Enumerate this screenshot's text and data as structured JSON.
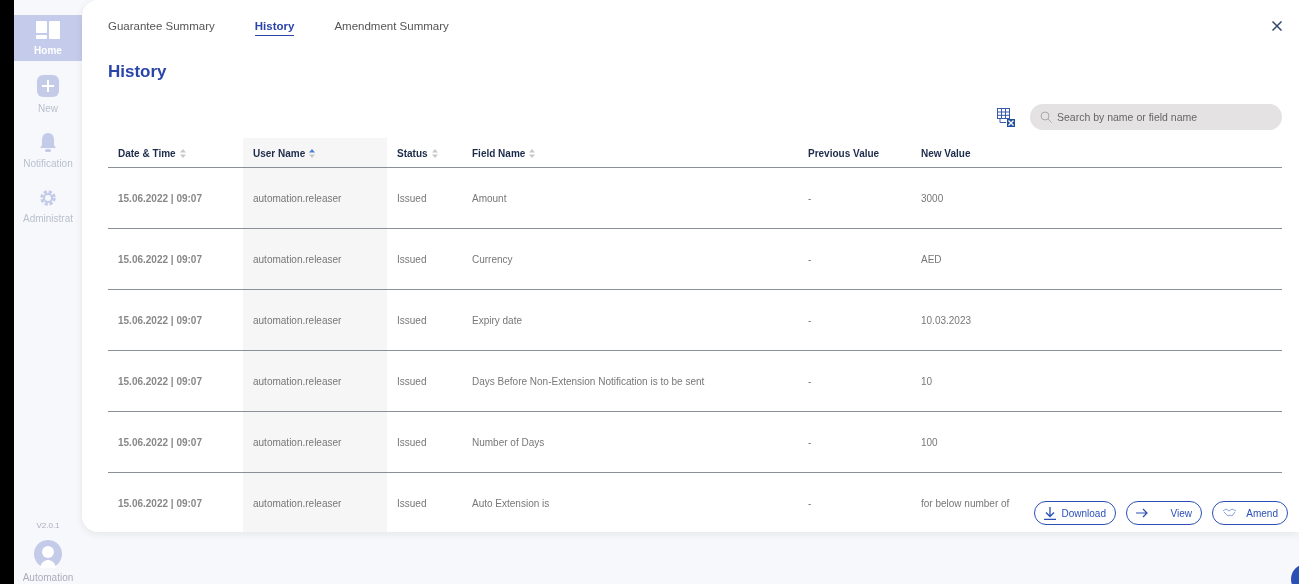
{
  "sidebar": {
    "items": [
      {
        "label": "Home",
        "kind": "home",
        "selected": true
      },
      {
        "label": "New",
        "kind": "new",
        "selected": false
      },
      {
        "label": "Notification",
        "kind": "bell",
        "selected": false
      },
      {
        "label": "Administrat",
        "kind": "gear",
        "selected": false
      }
    ],
    "version": "V2.0.1",
    "user": "Automation"
  },
  "tabs": [
    {
      "label": "Guarantee Summary",
      "selected": false
    },
    {
      "label": "History",
      "selected": true
    },
    {
      "label": "Amendment Summary",
      "selected": false
    }
  ],
  "title": "History",
  "search": {
    "placeholder": "Search by name or field name"
  },
  "table": {
    "columns": [
      {
        "label": "Date & Time",
        "kind": "sortable"
      },
      {
        "label": "User Name",
        "kind": "sorted"
      },
      {
        "label": "Status",
        "kind": "sortable"
      },
      {
        "label": "Field Name",
        "kind": "sortable"
      },
      {
        "label": "Previous Value",
        "kind": "plain"
      },
      {
        "label": "New Value",
        "kind": "plain"
      }
    ],
    "rows": [
      [
        "15.06.2022 | 09:07",
        "automation.releaser",
        "Issued",
        "Amount",
        "-",
        "3000"
      ],
      [
        "15.06.2022 | 09:07",
        "automation.releaser",
        "Issued",
        "Currency",
        "-",
        "AED"
      ],
      [
        "15.06.2022 | 09:07",
        "automation.releaser",
        "Issued",
        "Expiry date",
        "-",
        "10.03.2023"
      ],
      [
        "15.06.2022 | 09:07",
        "automation.releaser",
        "Issued",
        "Days Before Non-Extension Notification is to be sent",
        "-",
        "10"
      ],
      [
        "15.06.2022 | 09:07",
        "automation.releaser",
        "Issued",
        "Number of Days",
        "-",
        "100"
      ],
      [
        "15.06.2022 | 09:07",
        "automation.releaser",
        "Issued",
        "Auto Extension is",
        "-",
        "for below number of"
      ]
    ]
  },
  "actions": [
    {
      "label": "Download",
      "kind": "download"
    },
    {
      "label": "View",
      "kind": "arrow"
    },
    {
      "label": "Amend",
      "kind": "handshake"
    }
  ]
}
